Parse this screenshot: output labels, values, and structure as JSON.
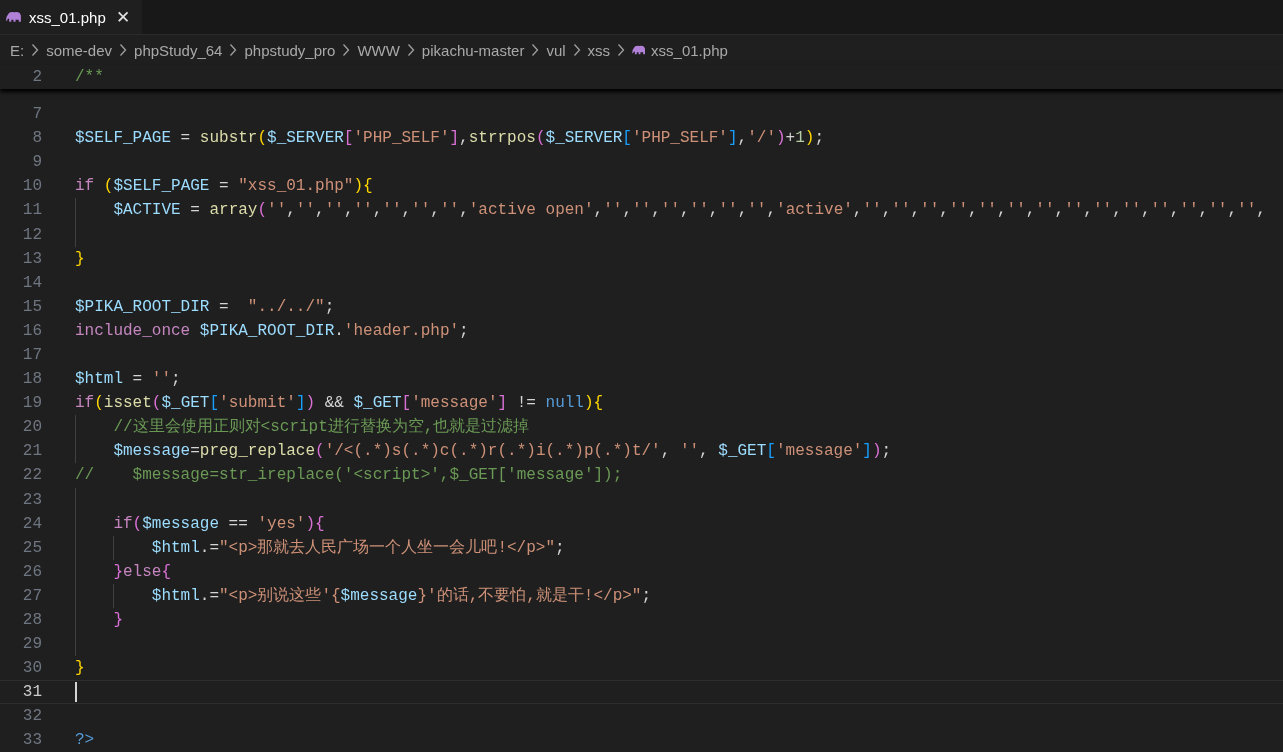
{
  "tabs": [
    {
      "label": "xss_01.php",
      "selected": true,
      "close": "✕"
    }
  ],
  "breadcrumbs": [
    {
      "label": "E:",
      "kind": "folder"
    },
    {
      "label": "some-dev",
      "kind": "folder"
    },
    {
      "label": "phpStudy_64",
      "kind": "folder"
    },
    {
      "label": "phpstudy_pro",
      "kind": "folder"
    },
    {
      "label": "WWW",
      "kind": "folder"
    },
    {
      "label": "pikachu-master",
      "kind": "folder"
    },
    {
      "label": "vul",
      "kind": "folder"
    },
    {
      "label": "xss",
      "kind": "folder"
    },
    {
      "label": "xss_01.php",
      "kind": "php"
    }
  ],
  "sticky_scroll": {
    "number": "2",
    "tokens": [
      {
        "kind": "cm",
        "text": "/**"
      }
    ]
  },
  "lines": [
    {
      "number": "7",
      "current": false
    },
    {
      "number": "8",
      "current": false,
      "tokens": [
        {
          "kind": "var",
          "text": "$SELF_PAGE"
        },
        {
          "kind": "plain",
          "text": " = "
        },
        {
          "kind": "fn",
          "text": "substr"
        },
        {
          "kind": "b1",
          "text": "("
        },
        {
          "kind": "var",
          "text": "$_SERVER"
        },
        {
          "kind": "b2",
          "text": "["
        },
        {
          "kind": "str",
          "text": "'PHP_SELF'"
        },
        {
          "kind": "b2",
          "text": "]"
        },
        {
          "kind": "plain",
          "text": ","
        },
        {
          "kind": "fn",
          "text": "strrpos"
        },
        {
          "kind": "b2",
          "text": "("
        },
        {
          "kind": "var",
          "text": "$_SERVER"
        },
        {
          "kind": "b3",
          "text": "["
        },
        {
          "kind": "str",
          "text": "'PHP_SELF'"
        },
        {
          "kind": "b3",
          "text": "]"
        },
        {
          "kind": "plain",
          "text": ","
        },
        {
          "kind": "str",
          "text": "'/'"
        },
        {
          "kind": "b2",
          "text": ")"
        },
        {
          "kind": "plain",
          "text": "+"
        },
        {
          "kind": "num",
          "text": "1"
        },
        {
          "kind": "b1",
          "text": ")"
        },
        {
          "kind": "plain",
          "text": ";"
        }
      ]
    },
    {
      "number": "9",
      "current": false
    },
    {
      "number": "10",
      "current": false,
      "tokens": [
        {
          "kind": "kw",
          "text": "if "
        },
        {
          "kind": "b1",
          "text": "("
        },
        {
          "kind": "var",
          "text": "$SELF_PAGE"
        },
        {
          "kind": "plain",
          "text": " = "
        },
        {
          "kind": "str",
          "text": "\"xss_01.php\""
        },
        {
          "kind": "b1",
          "text": ")"
        },
        {
          "kind": "b1",
          "text": "{"
        }
      ]
    },
    {
      "number": "11",
      "current": false,
      "guides": [
        {
          "kind": "line"
        }
      ],
      "tokens": [
        {
          "kind": "var",
          "text": "$ACTIVE"
        },
        {
          "kind": "plain",
          "text": " = "
        },
        {
          "kind": "fn",
          "text": "array"
        },
        {
          "kind": "b2",
          "text": "("
        },
        {
          "kind": "str",
          "text": "''"
        },
        {
          "kind": "plain",
          "text": ","
        },
        {
          "kind": "str",
          "text": "''"
        },
        {
          "kind": "plain",
          "text": ","
        },
        {
          "kind": "str",
          "text": "''"
        },
        {
          "kind": "plain",
          "text": ","
        },
        {
          "kind": "str",
          "text": "''"
        },
        {
          "kind": "plain",
          "text": ","
        },
        {
          "kind": "str",
          "text": "''"
        },
        {
          "kind": "plain",
          "text": ","
        },
        {
          "kind": "str",
          "text": "''"
        },
        {
          "kind": "plain",
          "text": ","
        },
        {
          "kind": "str",
          "text": "''"
        },
        {
          "kind": "plain",
          "text": ","
        },
        {
          "kind": "str",
          "text": "'active open'"
        },
        {
          "kind": "plain",
          "text": ","
        },
        {
          "kind": "str",
          "text": "''"
        },
        {
          "kind": "plain",
          "text": ","
        },
        {
          "kind": "str",
          "text": "''"
        },
        {
          "kind": "plain",
          "text": ","
        },
        {
          "kind": "str",
          "text": "''"
        },
        {
          "kind": "plain",
          "text": ","
        },
        {
          "kind": "str",
          "text": "''"
        },
        {
          "kind": "plain",
          "text": ","
        },
        {
          "kind": "str",
          "text": "''"
        },
        {
          "kind": "plain",
          "text": ","
        },
        {
          "kind": "str",
          "text": "''"
        },
        {
          "kind": "plain",
          "text": ","
        },
        {
          "kind": "str",
          "text": "'active'"
        },
        {
          "kind": "plain",
          "text": ","
        },
        {
          "kind": "str",
          "text": "''"
        },
        {
          "kind": "plain",
          "text": ","
        },
        {
          "kind": "str",
          "text": "''"
        },
        {
          "kind": "plain",
          "text": ","
        },
        {
          "kind": "str",
          "text": "''"
        },
        {
          "kind": "plain",
          "text": ","
        },
        {
          "kind": "str",
          "text": "''"
        },
        {
          "kind": "plain",
          "text": ","
        },
        {
          "kind": "str",
          "text": "''"
        },
        {
          "kind": "plain",
          "text": ","
        },
        {
          "kind": "str",
          "text": "''"
        },
        {
          "kind": "plain",
          "text": ","
        },
        {
          "kind": "str",
          "text": "''"
        },
        {
          "kind": "plain",
          "text": ","
        },
        {
          "kind": "str",
          "text": "''"
        },
        {
          "kind": "plain",
          "text": ","
        },
        {
          "kind": "str",
          "text": "''"
        },
        {
          "kind": "plain",
          "text": ","
        },
        {
          "kind": "str",
          "text": "''"
        },
        {
          "kind": "plain",
          "text": ","
        },
        {
          "kind": "str",
          "text": "''"
        },
        {
          "kind": "plain",
          "text": ","
        },
        {
          "kind": "str",
          "text": "''"
        },
        {
          "kind": "plain",
          "text": ","
        },
        {
          "kind": "str",
          "text": "''"
        },
        {
          "kind": "plain",
          "text": ","
        },
        {
          "kind": "str",
          "text": "''"
        },
        {
          "kind": "plain",
          "text": ","
        }
      ]
    },
    {
      "number": "12",
      "current": false,
      "guides": [
        {
          "kind": "line"
        }
      ]
    },
    {
      "number": "13",
      "current": false,
      "tokens": [
        {
          "kind": "b1",
          "text": "}"
        }
      ]
    },
    {
      "number": "14",
      "current": false
    },
    {
      "number": "15",
      "current": false,
      "tokens": [
        {
          "kind": "var",
          "text": "$PIKA_ROOT_DIR"
        },
        {
          "kind": "plain",
          "text": " =  "
        },
        {
          "kind": "str",
          "text": "\"../../\""
        },
        {
          "kind": "plain",
          "text": ";"
        }
      ]
    },
    {
      "number": "16",
      "current": false,
      "tokens": [
        {
          "kind": "kw",
          "text": "include_once "
        },
        {
          "kind": "var",
          "text": "$PIKA_ROOT_DIR"
        },
        {
          "kind": "plain",
          "text": "."
        },
        {
          "kind": "str",
          "text": "'header.php'"
        },
        {
          "kind": "plain",
          "text": ";"
        }
      ]
    },
    {
      "number": "17",
      "current": false
    },
    {
      "number": "18",
      "current": false,
      "tokens": [
        {
          "kind": "var",
          "text": "$html"
        },
        {
          "kind": "plain",
          "text": " = "
        },
        {
          "kind": "str",
          "text": "''"
        },
        {
          "kind": "plain",
          "text": ";"
        }
      ]
    },
    {
      "number": "19",
      "current": false,
      "tokens": [
        {
          "kind": "kw",
          "text": "if"
        },
        {
          "kind": "b1",
          "text": "("
        },
        {
          "kind": "fn",
          "text": "isset"
        },
        {
          "kind": "b2",
          "text": "("
        },
        {
          "kind": "var",
          "text": "$_GET"
        },
        {
          "kind": "b3",
          "text": "["
        },
        {
          "kind": "str",
          "text": "'submit'"
        },
        {
          "kind": "b3",
          "text": "]"
        },
        {
          "kind": "b2",
          "text": ")"
        },
        {
          "kind": "plain",
          "text": " && "
        },
        {
          "kind": "var",
          "text": "$_GET"
        },
        {
          "kind": "b2",
          "text": "["
        },
        {
          "kind": "str",
          "text": "'message'"
        },
        {
          "kind": "b2",
          "text": "]"
        },
        {
          "kind": "plain",
          "text": " != "
        },
        {
          "kind": "const",
          "text": "null"
        },
        {
          "kind": "b1",
          "text": ")"
        },
        {
          "kind": "b1",
          "text": "{"
        }
      ]
    },
    {
      "number": "20",
      "current": false,
      "guides": [
        {
          "kind": "line"
        }
      ],
      "tokens": [
        {
          "kind": "cm",
          "text": "//这里会使用正则对<script进行替换为空,也就是过滤掉"
        }
      ]
    },
    {
      "number": "21",
      "current": false,
      "guides": [
        {
          "kind": "line"
        }
      ],
      "tokens": [
        {
          "kind": "var",
          "text": "$message"
        },
        {
          "kind": "plain",
          "text": "="
        },
        {
          "kind": "fn",
          "text": "preg_replace"
        },
        {
          "kind": "b2",
          "text": "("
        },
        {
          "kind": "str",
          "text": "'/<(.*)s(.*)c(.*)r(.*)i(.*)p(.*)t/'"
        },
        {
          "kind": "plain",
          "text": ", "
        },
        {
          "kind": "str",
          "text": "''"
        },
        {
          "kind": "plain",
          "text": ", "
        },
        {
          "kind": "var",
          "text": "$_GET"
        },
        {
          "kind": "b3",
          "text": "["
        },
        {
          "kind": "str",
          "text": "'message'"
        },
        {
          "kind": "b3",
          "text": "]"
        },
        {
          "kind": "b2",
          "text": ")"
        },
        {
          "kind": "plain",
          "text": ";"
        }
      ]
    },
    {
      "number": "22",
      "current": false,
      "tokens": [
        {
          "kind": "cm",
          "text": "//    $message=str_ireplace('<script>',$_GET['message']);"
        }
      ]
    },
    {
      "number": "23",
      "current": false,
      "guides": [
        {
          "kind": "line"
        }
      ]
    },
    {
      "number": "24",
      "current": false,
      "guides": [
        {
          "kind": "line"
        }
      ],
      "tokens": [
        {
          "kind": "kw",
          "text": "if"
        },
        {
          "kind": "b2",
          "text": "("
        },
        {
          "kind": "var",
          "text": "$message"
        },
        {
          "kind": "plain",
          "text": " == "
        },
        {
          "kind": "str",
          "text": "'yes'"
        },
        {
          "kind": "b2",
          "text": ")"
        },
        {
          "kind": "b2",
          "text": "{"
        }
      ]
    },
    {
      "number": "25",
      "current": false,
      "guides": [
        {
          "kind": "line"
        },
        {
          "kind": "line"
        }
      ],
      "tokens": [
        {
          "kind": "var",
          "text": "$html"
        },
        {
          "kind": "plain",
          "text": ".="
        },
        {
          "kind": "str",
          "text": "\"<p>那就去人民广场一个人坐一会儿吧!</p>\""
        },
        {
          "kind": "plain",
          "text": ";"
        }
      ]
    },
    {
      "number": "26",
      "current": false,
      "guides": [
        {
          "kind": "line"
        }
      ],
      "tokens": [
        {
          "kind": "b2",
          "text": "}"
        },
        {
          "kind": "kw",
          "text": "else"
        },
        {
          "kind": "b2",
          "text": "{"
        }
      ]
    },
    {
      "number": "27",
      "current": false,
      "guides": [
        {
          "kind": "line"
        },
        {
          "kind": "line"
        }
      ],
      "tokens": [
        {
          "kind": "var",
          "text": "$html"
        },
        {
          "kind": "plain",
          "text": ".="
        },
        {
          "kind": "str",
          "text": "\"<p>别说这些'{"
        },
        {
          "kind": "var",
          "text": "$message"
        },
        {
          "kind": "str",
          "text": "}'的话,不要怕,就是干!</p>\""
        },
        {
          "kind": "plain",
          "text": ";"
        }
      ]
    },
    {
      "number": "28",
      "current": false,
      "guides": [
        {
          "kind": "line"
        }
      ],
      "tokens": [
        {
          "kind": "b2",
          "text": "}"
        }
      ]
    },
    {
      "number": "29",
      "current": false,
      "guides": [
        {
          "kind": "line"
        }
      ]
    },
    {
      "number": "30",
      "current": false,
      "tokens": [
        {
          "kind": "b1",
          "text": "}"
        }
      ]
    },
    {
      "number": "31",
      "current": true
    },
    {
      "number": "32",
      "current": false
    },
    {
      "number": "33",
      "current": false,
      "tokens": [
        {
          "kind": "const",
          "text": "?>"
        }
      ]
    }
  ]
}
